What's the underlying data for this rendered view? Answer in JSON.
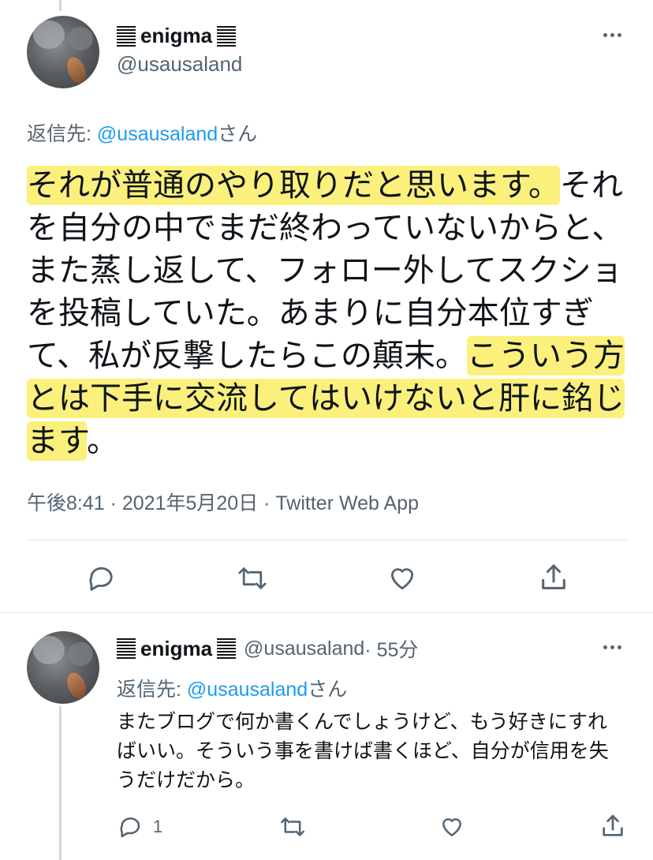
{
  "main_tweet": {
    "display_name": "enigma",
    "handle": "@usausaland",
    "reply_prefix": "返信先: ",
    "reply_mention": "@usausaland",
    "reply_suffix": "さん",
    "text_segments": [
      {
        "text": "それが普通のやり取りだと思います。",
        "highlight": true
      },
      {
        "text": "それを自分の中でまだ終わっていないからと、また蒸し返して、フォロー外してスクショを投稿していた。あまりに自分本位すぎて、私が反撃したらこの顛末。",
        "highlight": false
      },
      {
        "text": "こういう方とは下手に交流してはいけないと肝に銘じます",
        "highlight": true
      },
      {
        "text": "。",
        "highlight": false
      }
    ],
    "timestamp": "午後8:41 · 2021年5月20日 · Twitter Web App",
    "actions": {
      "reply_icon": "reply-icon",
      "retweet_icon": "retweet-icon",
      "like_icon": "like-icon",
      "share_icon": "share-icon"
    }
  },
  "reply_tweet": {
    "display_name": "enigma",
    "handle": "@usausaland",
    "time": " · 55分",
    "reply_prefix": "返信先: ",
    "reply_mention": "@usausaland",
    "reply_suffix": "さん",
    "text": "またブログで何か書くんでしょうけど、もう好きにすればいい。そういう事を書けば書くほど、自分が信用を失うだけだから。",
    "reply_count": "1"
  },
  "colors": {
    "text": "#0f1419",
    "secondary": "#536471",
    "accent": "#1d9bf0",
    "highlight": "#fbf07c"
  }
}
